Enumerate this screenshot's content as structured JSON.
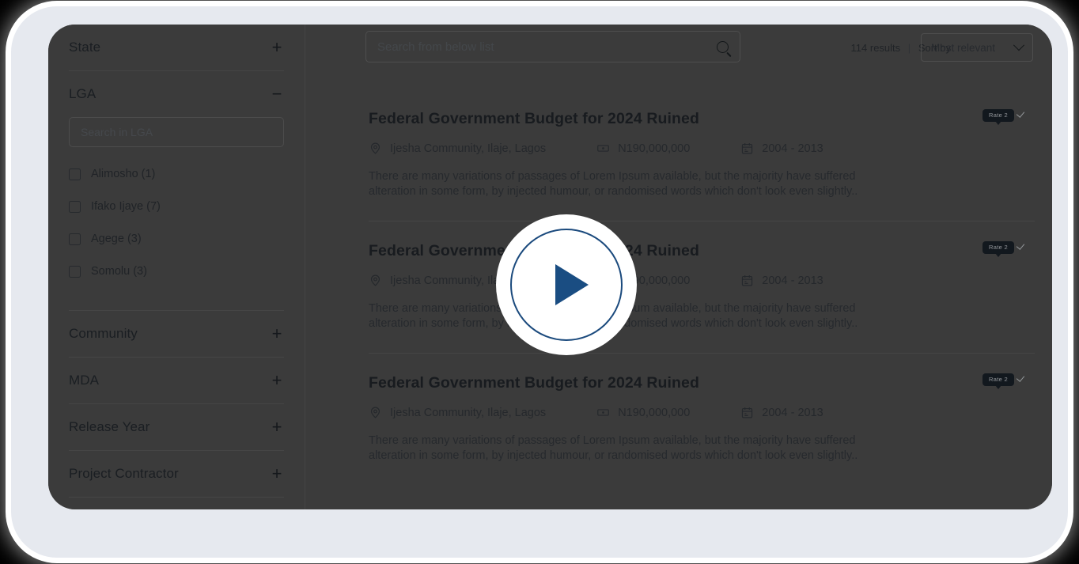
{
  "sidebar": {
    "facets": [
      {
        "title": "State",
        "toggle": "+",
        "expanded": false
      },
      {
        "title": "LGA",
        "toggle": "−",
        "expanded": true,
        "search_placeholder": "Search in LGA",
        "options": [
          {
            "label": "Alimosho (1)",
            "checked": false
          },
          {
            "label": "Ifako Ijaye (7)",
            "checked": false
          },
          {
            "label": "Agege (3)",
            "checked": false
          },
          {
            "label": "Somolu (3)",
            "checked": false
          }
        ]
      },
      {
        "title": "Community",
        "toggle": "+",
        "expanded": false
      },
      {
        "title": "MDA",
        "toggle": "+",
        "expanded": false
      },
      {
        "title": "Release Year",
        "toggle": "+",
        "expanded": false
      },
      {
        "title": "Project Contractor",
        "toggle": "+",
        "expanded": false
      }
    ]
  },
  "topbar": {
    "search_placeholder": "Search from below list",
    "search_value": "",
    "search_icon": "search-icon",
    "results_count": "114 results",
    "separator": "|",
    "sort_label": "Sort by",
    "sort_value": "Most relevant",
    "sort_options": [
      "Most relevant"
    ]
  },
  "results": {
    "cards": [
      {
        "title": "Federal Government Budget for 2024 Ruined",
        "location": "Ijesha Community, Ilaje, Lagos",
        "amount": "N190,000,000",
        "period": "2004 - 2013",
        "description": "There are many variations of passages of Lorem Ipsum available, but the majority have suffered alteration in some form, by injected humour, or randomised words which don't look even slightly..",
        "rate_label": "Rate 2"
      },
      {
        "title": "Federal Government Budget for 2024 Ruined",
        "location": "Ijesha Community, Ilaje, Lagos",
        "amount": "N190,000,000",
        "period": "2004 - 2013",
        "description": "There are many variations of passages of Lorem Ipsum available, but the majority have suffered alteration in some form, by injected humour, or randomised words which don't look even slightly..",
        "rate_label": "Rate 2"
      },
      {
        "title": "Federal Government Budget for 2024 Ruined",
        "location": "Ijesha Community, Ilaje, Lagos",
        "amount": "N190,000,000",
        "period": "2004 - 2013",
        "description": "There are many variations of passages of Lorem Ipsum available, but the majority have suffered alteration in some form, by injected humour, or randomised words which don't look even slightly..",
        "rate_label": "Rate 2"
      }
    ]
  },
  "overlay": {
    "play_icon": "play-triangle-icon"
  },
  "colors": {
    "screen_bg": "#5d5d5d",
    "frame_bg": "#e6e9ef",
    "play_blue": "#1a4d82",
    "badge_dark": "#1d2630",
    "check_blue": "#1d6a94"
  }
}
